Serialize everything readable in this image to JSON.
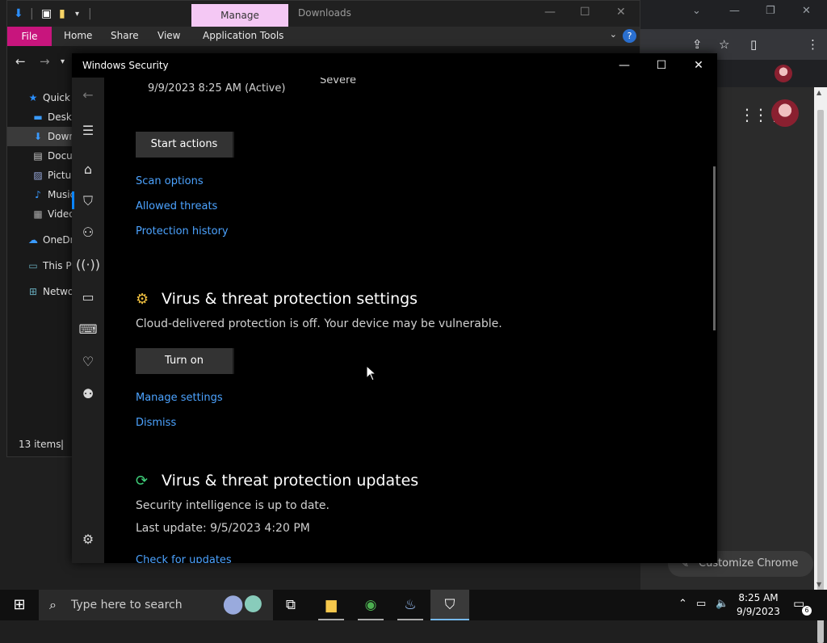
{
  "explorer": {
    "manage_tab": "Manage",
    "window_title": "Downloads",
    "ribbon_tabs": [
      "File",
      "Home",
      "Share",
      "View",
      "Application Tools"
    ],
    "nav_items": [
      {
        "label": "Quick access",
        "icon": "star-icon"
      },
      {
        "label": "Desktop",
        "icon": "desktop-icon"
      },
      {
        "label": "Downloads",
        "icon": "download-icon"
      },
      {
        "label": "Documents",
        "icon": "document-icon"
      },
      {
        "label": "Pictures",
        "icon": "picture-icon"
      },
      {
        "label": "Music",
        "icon": "music-icon"
      },
      {
        "label": "Videos",
        "icon": "video-icon"
      },
      {
        "label": "OneDrive",
        "icon": "cloud-icon"
      },
      {
        "label": "This PC",
        "icon": "computer-icon"
      },
      {
        "label": "Network",
        "icon": "network-icon"
      }
    ],
    "status": "13 items"
  },
  "chrome": {
    "customize_label": "Customize Chrome"
  },
  "security": {
    "title": "Windows Security",
    "top": {
      "date_active": "9/9/2023 8:25 AM (Active)",
      "severity": "Severe"
    },
    "start_actions_label": "Start actions",
    "links": {
      "scan_options": "Scan options",
      "allowed_threats": "Allowed threats",
      "protection_history": "Protection history"
    },
    "settings_section": {
      "heading": "Virus & threat protection settings",
      "description": "Cloud-delivered protection is off. Your device may be vulnerable.",
      "turn_on_label": "Turn on",
      "manage_settings": "Manage settings",
      "dismiss": "Dismiss"
    },
    "updates_section": {
      "heading": "Virus & threat protection updates",
      "status": "Security intelligence is up to date.",
      "last_update": "Last update: 9/5/2023 4:20 PM",
      "check_updates": "Check for updates"
    }
  },
  "taskbar": {
    "search_placeholder": "Type here to search",
    "time": "8:25 AM",
    "date": "9/9/2023",
    "notification_count": "6"
  },
  "colors": {
    "accent_link": "#4ca3ff",
    "file_tab": "#c8157d",
    "manage_tab": "#f4c8f4"
  }
}
